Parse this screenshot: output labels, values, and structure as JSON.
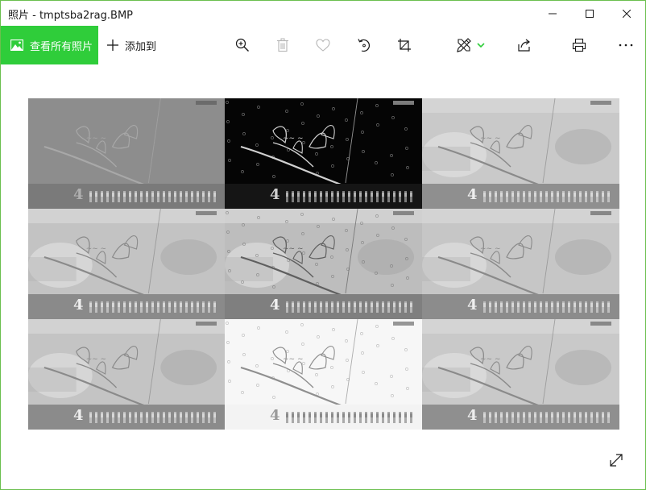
{
  "window": {
    "title": "照片 - tmptsba2rag.BMP",
    "controls": [
      "minimize-icon",
      "maximize-icon",
      "close-icon"
    ]
  },
  "toolbar": {
    "all_photos_label": "查看所有照片",
    "add_to_label": "添加到",
    "icons": [
      "zoom-in-icon",
      "delete-icon",
      "favorite-heart-icon",
      "rotate-icon",
      "crop-icon",
      "edit-draw-icon",
      "share-icon",
      "print-icon",
      "more-icon"
    ]
  },
  "image": {
    "tiles": [
      {
        "style": "emboss",
        "bg": "#8a8a8a",
        "band": "#7a7a7a",
        "ink": "#a8a8a8",
        "num": "#b0b0b0"
      },
      {
        "style": "edges",
        "bg": "#050505",
        "band": "#151515",
        "ink": "#d0d0d0",
        "num": "#cfcfcf"
      },
      {
        "style": "gray",
        "bg": "#c9c9c9",
        "band": "#8f8f8f",
        "ink": "#8a8a8a",
        "num": "#eeeeee"
      },
      {
        "style": "gray",
        "bg": "#c3c3c3",
        "band": "#8a8a8a",
        "ink": "#8a8a8a",
        "num": "#eeeeee"
      },
      {
        "style": "sharpen",
        "bg": "#bdbdbd",
        "band": "#7f7f7f",
        "ink": "#5f5f5f",
        "num": "#f0f0f0"
      },
      {
        "style": "gray",
        "bg": "#c6c6c6",
        "band": "#8c8c8c",
        "ink": "#8a8a8a",
        "num": "#eeeeee"
      },
      {
        "style": "gray",
        "bg": "#c4c4c4",
        "band": "#8b8b8b",
        "ink": "#8a8a8a",
        "num": "#eeeeee"
      },
      {
        "style": "sketch",
        "bg": "#f7f7f7",
        "band": "#f3f3f3",
        "ink": "#8f8f8f",
        "num": "#9a9a9a"
      },
      {
        "style": "gray",
        "bg": "#c9c9c9",
        "band": "#8f8f8f",
        "ink": "#8a8a8a",
        "num": "#eeeeee"
      }
    ],
    "calendar_month": "4"
  },
  "colors": {
    "accent": "#2fcd3a",
    "window_border": "#6bbf4e"
  }
}
